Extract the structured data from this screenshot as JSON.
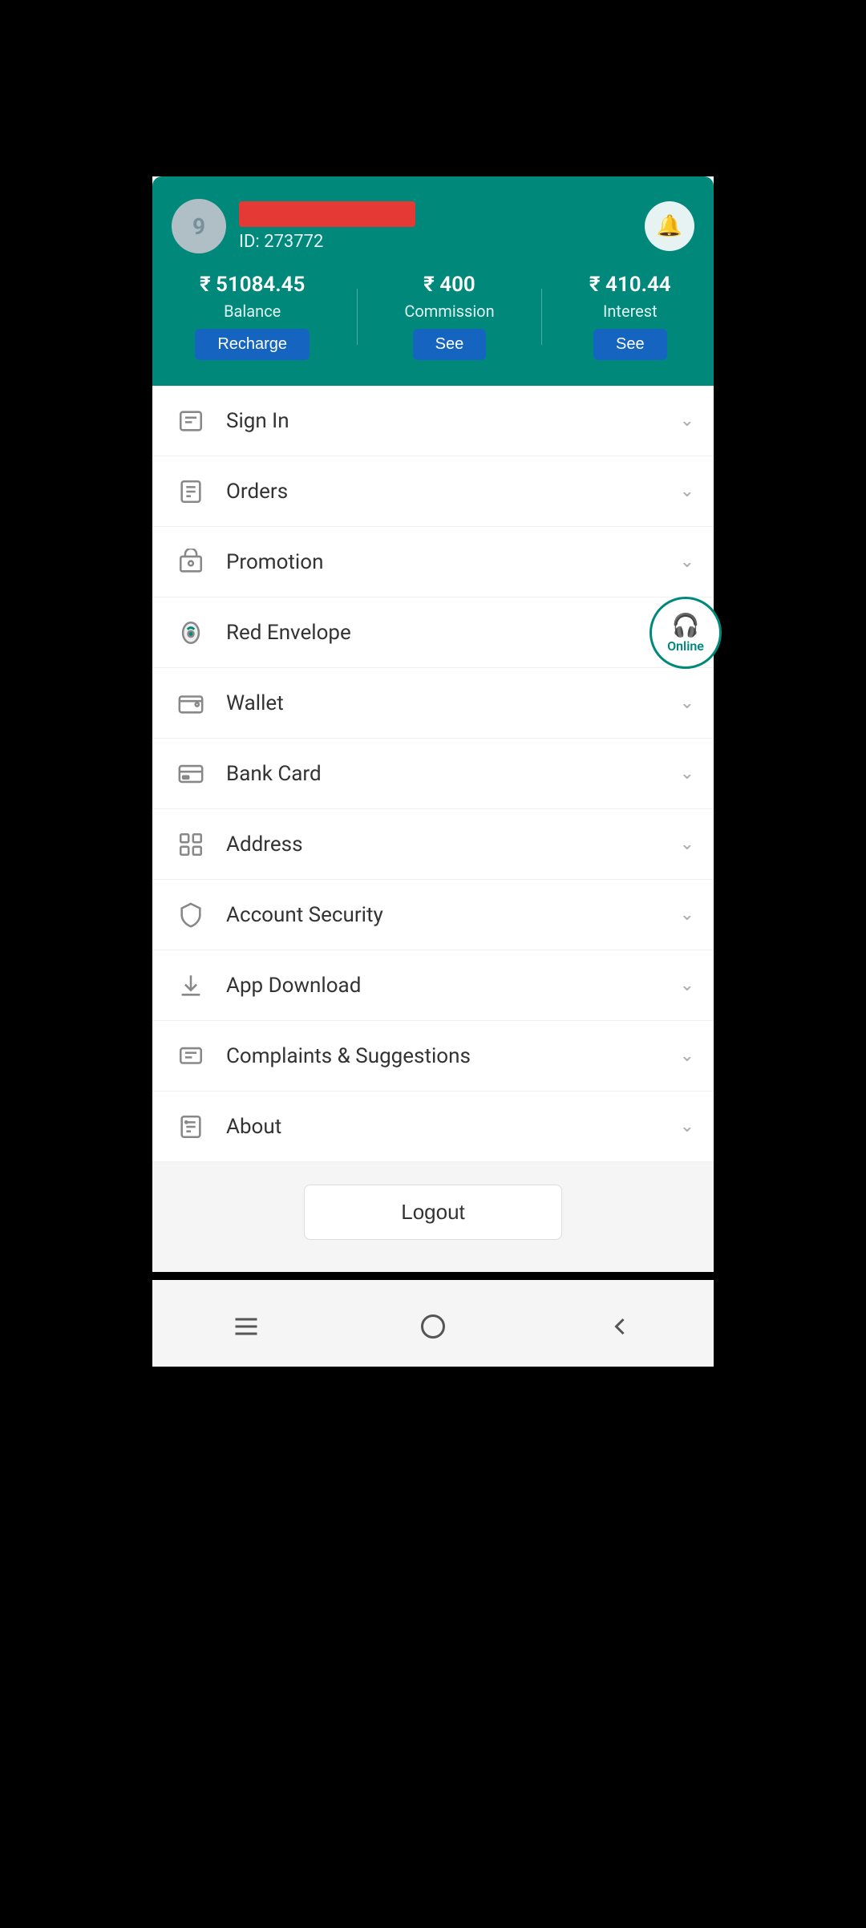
{
  "header": {
    "avatar_label": "9",
    "user_id_label": "ID:  273772",
    "balance_value": "₹ 51084.45",
    "balance_label": "Balance",
    "balance_btn": "Recharge",
    "commission_value": "₹ 400",
    "commission_label": "Commission",
    "commission_btn": "See",
    "interest_value": "₹ 410.44",
    "interest_label": "Interest",
    "interest_btn": "See"
  },
  "menu": {
    "items": [
      {
        "id": "sign-in",
        "label": "Sign In",
        "has_chevron": true
      },
      {
        "id": "orders",
        "label": "Orders",
        "has_chevron": true
      },
      {
        "id": "promotion",
        "label": "Promotion",
        "has_chevron": true
      },
      {
        "id": "red-envelope",
        "label": "Red Envelope",
        "has_chevron": true,
        "has_online": true
      },
      {
        "id": "wallet",
        "label": "Wallet",
        "has_chevron": true
      },
      {
        "id": "bank-card",
        "label": "Bank Card",
        "has_chevron": true
      },
      {
        "id": "address",
        "label": "Address",
        "has_chevron": true
      },
      {
        "id": "account-security",
        "label": "Account Security",
        "has_chevron": true
      },
      {
        "id": "app-download",
        "label": "App Download",
        "has_chevron": true
      },
      {
        "id": "complaints",
        "label": "Complaints & Suggestions",
        "has_chevron": true
      },
      {
        "id": "about",
        "label": "About",
        "has_chevron": true
      }
    ]
  },
  "online_label": "Online",
  "logout_label": "Logout",
  "colors": {
    "teal": "#00897B",
    "blue_btn": "#1565C0"
  }
}
